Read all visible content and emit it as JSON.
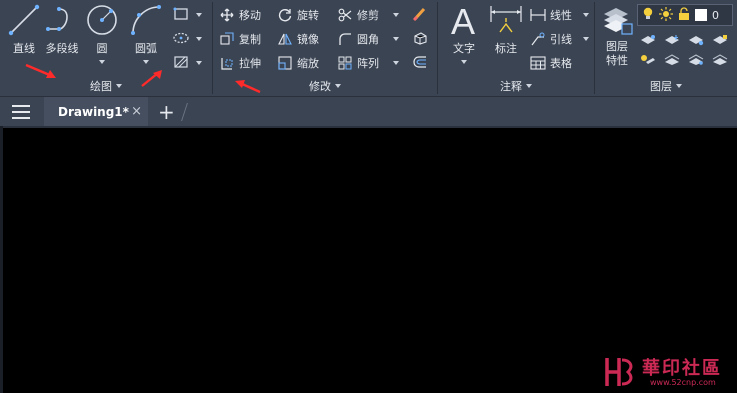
{
  "ribbon": {
    "draw": {
      "title": "绘图",
      "line_label": "直线",
      "polyline_label": "多段线",
      "circle_label": "圆",
      "arc_label": "圆弧"
    },
    "modify": {
      "title": "修改",
      "move_label": "移动",
      "rotate_label": "旋转",
      "trim_label": "修剪",
      "copy_label": "复制",
      "mirror_label": "镜像",
      "fillet_label": "圆角",
      "stretch_label": "拉伸",
      "scale_label": "缩放",
      "array_label": "阵列"
    },
    "annotation": {
      "title": "注释",
      "text_label": "文字",
      "dimension_label": "标注",
      "linear_label": "线性",
      "leader_label": "引线",
      "table_label": "表格"
    },
    "layers": {
      "title": "图层",
      "properties_label_1": "图层",
      "properties_label_2": "特性",
      "current_layer": "0"
    }
  },
  "tabs": [
    {
      "label": "Drawing1*",
      "close": "×"
    }
  ],
  "tab_plus": "+",
  "watermark": {
    "title": "華印社區",
    "url": "www.52cnp.com"
  },
  "colors": {
    "ribbon_bg": "#3b4453",
    "canvas_bg": "#000000",
    "icon_blue": "#6fb3ff",
    "annotation_arrow": "#ff2a2a",
    "watermark": "#cc2a55",
    "lightbulb": "#f4d03f"
  }
}
